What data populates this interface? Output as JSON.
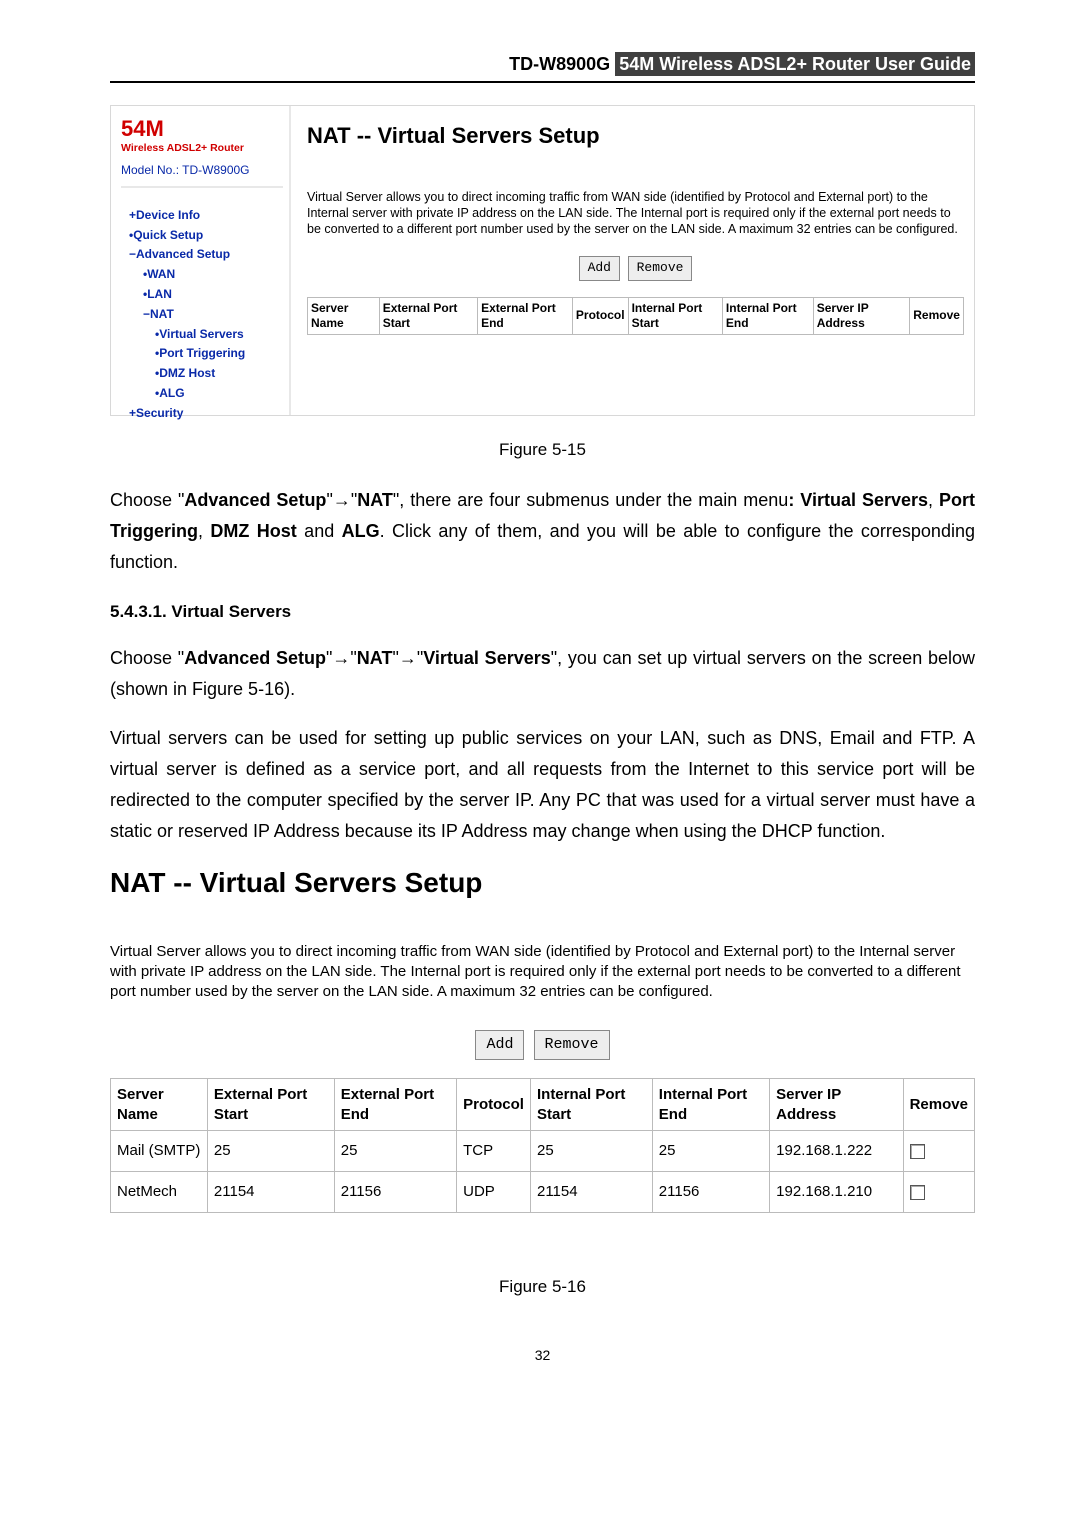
{
  "header": {
    "model": "TD-W8900G",
    "title": "54M Wireless ADSL2+ Router User Guide"
  },
  "fig515": {
    "sidebar": {
      "brand": "54M",
      "brand_sub": "Wireless ADSL2+ Router",
      "model_no_label": "Model No.:",
      "model_no_val": "TD-W8900G",
      "nav": {
        "device_info": "Device Info",
        "quick_setup": "Quick Setup",
        "advanced_setup": "Advanced Setup",
        "wan": "WAN",
        "lan": "LAN",
        "nat": "NAT",
        "virtual_servers": "Virtual Servers",
        "port_triggering": "Port Triggering",
        "dmz_host": "DMZ Host",
        "alg": "ALG",
        "security": "Security"
      }
    },
    "main": {
      "title": "NAT -- Virtual Servers Setup",
      "desc": "Virtual Server allows you to direct incoming traffic from WAN side (identified by Protocol and External port) to the Internal server with private IP address on the LAN side. The Internal port is required only if the external port needs to be converted to a different port number used by the server on the LAN side. A maximum 32 entries can be configured.",
      "btn_add": "Add",
      "btn_remove": "Remove",
      "cols": {
        "server_name": "Server Name",
        "ext_start": "External Port Start",
        "ext_end": "External Port End",
        "protocol": "Protocol",
        "int_start": "Internal Port Start",
        "int_end": "Internal Port End",
        "server_ip": "Server IP Address",
        "remove": "Remove"
      }
    },
    "caption": "Figure 5-15"
  },
  "para1": {
    "pre": "Choose \"",
    "b1": "Advanced Setup",
    "mid1": "\"→\"",
    "b2": "NAT",
    "mid2": "\", there are four submenus under the main menu",
    "b3": ": Virtual Servers",
    "mid3": ", ",
    "b4": "Port Triggering",
    "mid4": ", ",
    "b5": "DMZ Host",
    "mid5": " and ",
    "b6": "ALG",
    "tail": ". Click any of them, and you will be able to configure the corresponding function."
  },
  "section": {
    "num_title": "5.4.3.1.  Virtual Servers"
  },
  "para2": {
    "pre": "Choose \"",
    "b1": "Advanced Setup",
    "mid1": "\"→\"",
    "b2": "NAT",
    "mid2": "\"→\"",
    "b3": "Virtual Servers",
    "tail": "\", you can set up virtual servers on the screen below (shown in Figure 5-16)."
  },
  "para3": "Virtual servers can be used for setting up public services on your LAN, such as DNS, Email and FTP. A virtual server is defined as a service port, and all requests from the Internet to this service port will be redirected to the computer specified by the server IP. Any PC that was used for a virtual server must have a static or reserved IP Address because its IP Address may change when using the DHCP function.",
  "fig516": {
    "title": "NAT -- Virtual Servers Setup",
    "desc": "Virtual Server allows you to direct incoming traffic from WAN side (identified by Protocol and External port) to the Internal server with private IP address on the LAN side. The Internal port is required only if the external port needs to be converted to a different port number used by the server on the LAN side. A maximum 32 entries can be configured.",
    "btn_add": "Add",
    "btn_remove": "Remove",
    "cols": {
      "server_name": "Server Name",
      "ext_start": "External Port Start",
      "ext_end": "External Port End",
      "protocol": "Protocol",
      "int_start": "Internal Port Start",
      "int_end": "Internal Port End",
      "server_ip": "Server IP Address",
      "remove": "Remove"
    },
    "rows": [
      {
        "name": "Mail (SMTP)",
        "es": "25",
        "ee": "25",
        "proto": "TCP",
        "is": "25",
        "ie": "25",
        "ip": "192.168.1.222"
      },
      {
        "name": "NetMech",
        "es": "21154",
        "ee": "21156",
        "proto": "UDP",
        "is": "21154",
        "ie": "21156",
        "ip": "192.168.1.210"
      }
    ],
    "caption": "Figure 5-16"
  },
  "page_number": "32"
}
